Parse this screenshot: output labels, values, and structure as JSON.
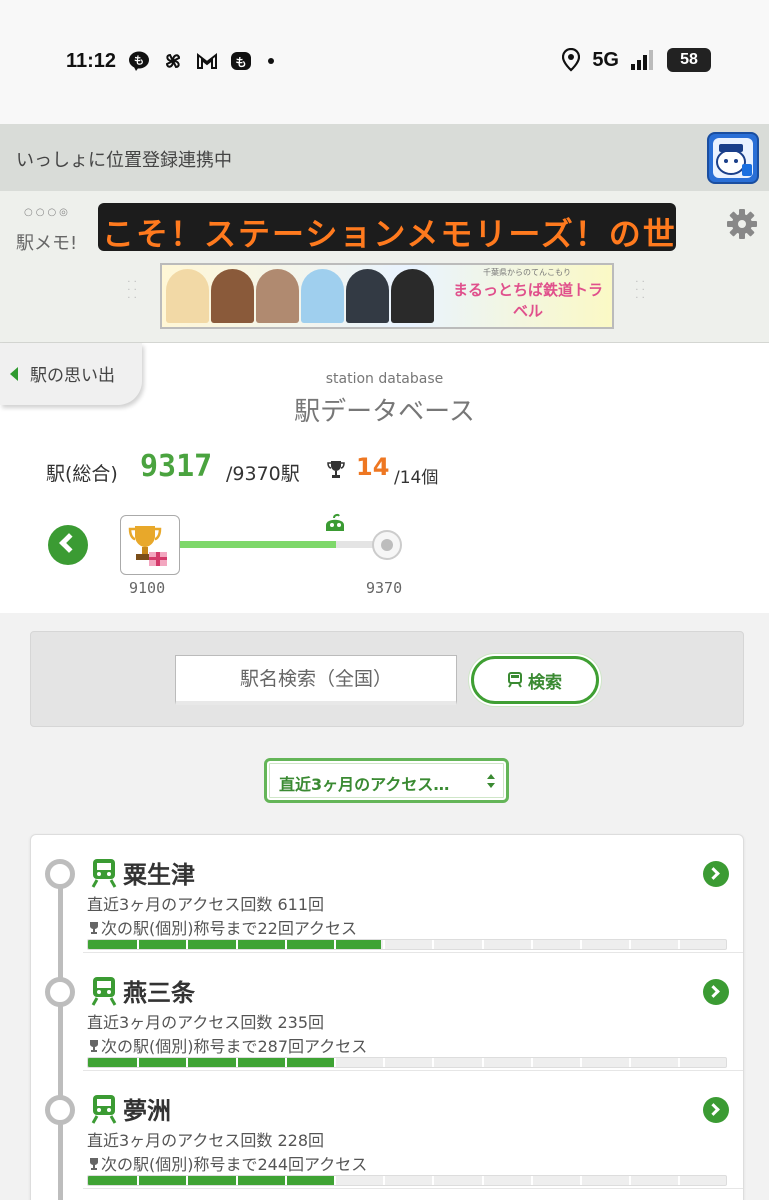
{
  "status_bar": {
    "time": "11:12",
    "left_icons": [
      "line-icon",
      "pinwheel-icon",
      "gmail-icon",
      "mercari-icon"
    ],
    "network": "5G",
    "battery": "58"
  },
  "sync_bar": {
    "text": "いっしょに位置登録連携中"
  },
  "header": {
    "logo_text": "駅メモ!",
    "marquee": "こそ！ステーションメモリーズ！の世界",
    "banner_title": "まるっとちば鉄道トラベル",
    "banner_subtitle": "千葉県からのてんこもり"
  },
  "nav": {
    "back_label": "駅の思い出"
  },
  "database": {
    "subtitle": "station database",
    "title": "駅データベース",
    "stat_label": "駅(総合)",
    "station_count": "9317",
    "station_total": "/9370駅",
    "trophy_count": "14",
    "trophy_total": "/14個",
    "progress": {
      "start_label": "9100",
      "end_label": "9370",
      "fraction": 0.8
    }
  },
  "search": {
    "placeholder": "駅名検索（全国）",
    "button_label": "検索"
  },
  "filter": {
    "selected": "直近3ヶ月のアクセス…"
  },
  "stations": [
    {
      "name": "粟生津",
      "access": "直近3ヶ月のアクセス回数 611回",
      "next": "次の駅(個別)称号まで22回アクセス",
      "progress": 0.46
    },
    {
      "name": "燕三条",
      "access": "直近3ヶ月のアクセス回数 235回",
      "next": "次の駅(個別)称号まで287回アクセス",
      "progress": 0.385
    },
    {
      "name": "夢洲",
      "access": "直近3ヶ月のアクセス回数 228回",
      "next": "次の駅(個別)称号まで244回アクセス",
      "progress": 0.385
    }
  ],
  "colors": {
    "accent_green": "#3b9b33",
    "count_green": "#4aa33f",
    "trophy_orange": "#ee7722",
    "marquee_orange": "#ff7a1e"
  }
}
